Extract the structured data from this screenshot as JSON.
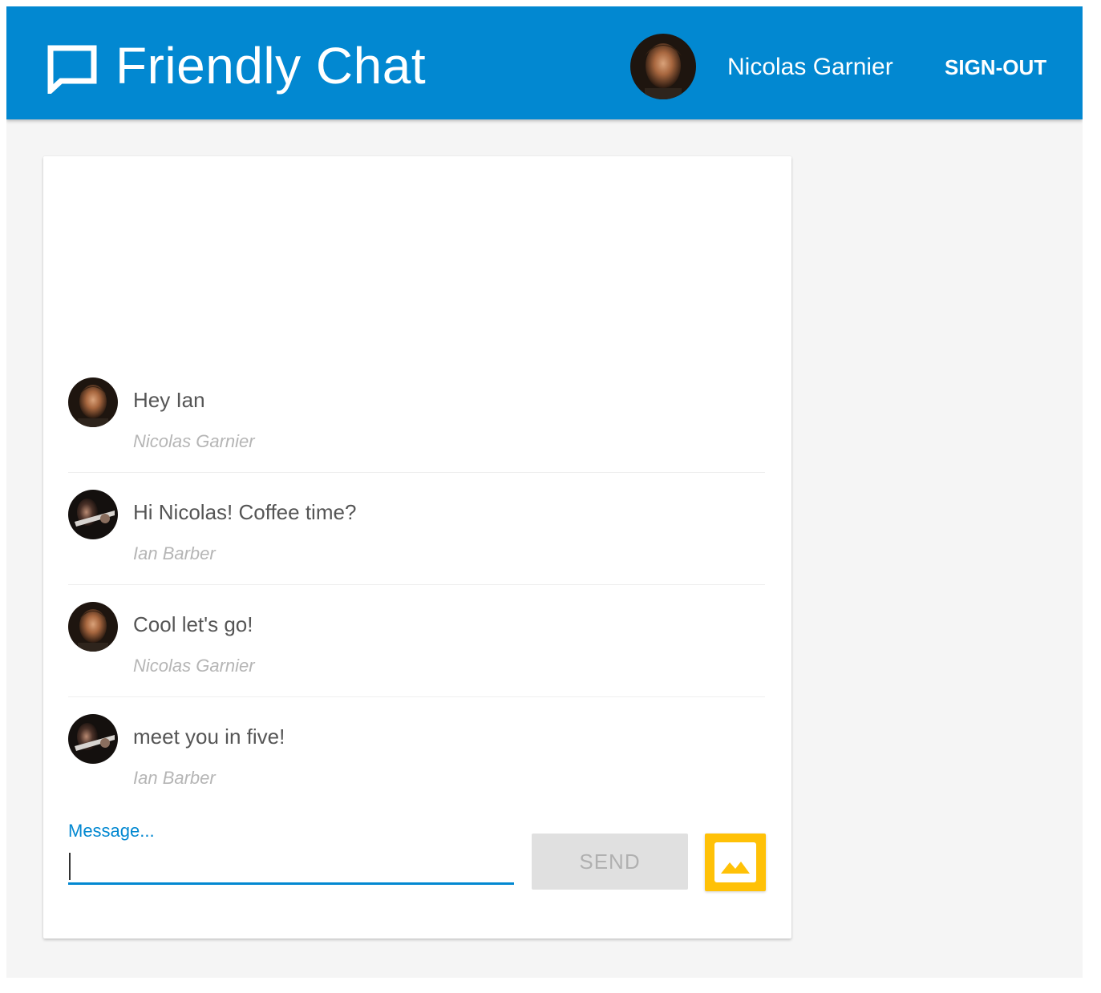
{
  "header": {
    "app_title": "Friendly Chat",
    "logo_icon": "chat-bubble-icon",
    "user": {
      "name": "Nicolas Garnier",
      "avatar": "user-avatar"
    },
    "signout_label": "SIGN-OUT"
  },
  "messages": [
    {
      "text": "Hey Ian",
      "sender": "Nicolas Garnier",
      "avatar": "nicolas-avatar"
    },
    {
      "text": "Hi Nicolas! Coffee time?",
      "sender": "Ian Barber",
      "avatar": "ian-avatar"
    },
    {
      "text": "Cool let's go!",
      "sender": "Nicolas Garnier",
      "avatar": "nicolas-avatar"
    },
    {
      "text": "meet you in five!",
      "sender": "Ian Barber",
      "avatar": "ian-avatar"
    }
  ],
  "composer": {
    "label": "Message...",
    "value": "",
    "send_label": "SEND",
    "image_button_icon": "image-icon"
  },
  "colors": {
    "primary": "#0288d1",
    "accent": "#ffc107",
    "background": "#f5f5f5"
  }
}
